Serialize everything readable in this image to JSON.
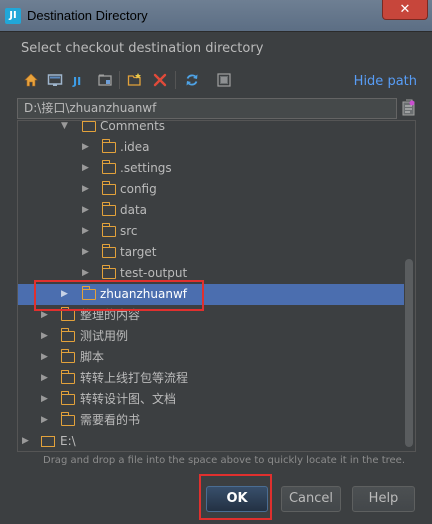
{
  "window": {
    "title": "Destination Directory",
    "app_icon_glyph": "JI",
    "close_glyph": "✕",
    "accent_color": "#4b6eaf",
    "highlight_color": "#e0302e"
  },
  "prompt": "Select checkout destination directory",
  "toolbar": {
    "icons": [
      "home-icon",
      "desktop-icon",
      "project-icon",
      "module-icon",
      "new-folder-icon",
      "delete-icon",
      "refresh-icon",
      "show-hidden-icon"
    ],
    "hide_path_label": "Hide path"
  },
  "path_field": {
    "value": "D:\\接口\\zhuanzhuanwf"
  },
  "tree": {
    "rows": [
      {
        "label": "Comments",
        "expanded": true,
        "level": 2
      },
      {
        "label": ".idea",
        "expanded": false,
        "level": 3
      },
      {
        "label": ".settings",
        "expanded": false,
        "level": 3
      },
      {
        "label": "config",
        "expanded": false,
        "level": 3
      },
      {
        "label": "data",
        "expanded": false,
        "level": 3
      },
      {
        "label": "src",
        "expanded": false,
        "level": 3
      },
      {
        "label": "target",
        "expanded": false,
        "level": 3
      },
      {
        "label": "test-output",
        "expanded": false,
        "level": 3
      },
      {
        "label": "zhuanzhuanwf",
        "expanded": false,
        "level": 2,
        "selected": true
      },
      {
        "label": "整理的内容",
        "expanded": false,
        "level": 1
      },
      {
        "label": "测试用例",
        "expanded": false,
        "level": 1
      },
      {
        "label": "脚本",
        "expanded": false,
        "level": 1
      },
      {
        "label": "转转上线打包等流程",
        "expanded": false,
        "level": 1
      },
      {
        "label": "转转设计图、文档",
        "expanded": false,
        "level": 1
      },
      {
        "label": "需要看的书",
        "expanded": false,
        "level": 1
      },
      {
        "label": "E:\\",
        "expanded": false,
        "level": 0,
        "drive": true
      }
    ]
  },
  "hint": "Drag and drop a file into the space above to quickly locate it in the tree.",
  "buttons": {
    "ok": "OK",
    "cancel": "Cancel",
    "help": "Help"
  }
}
